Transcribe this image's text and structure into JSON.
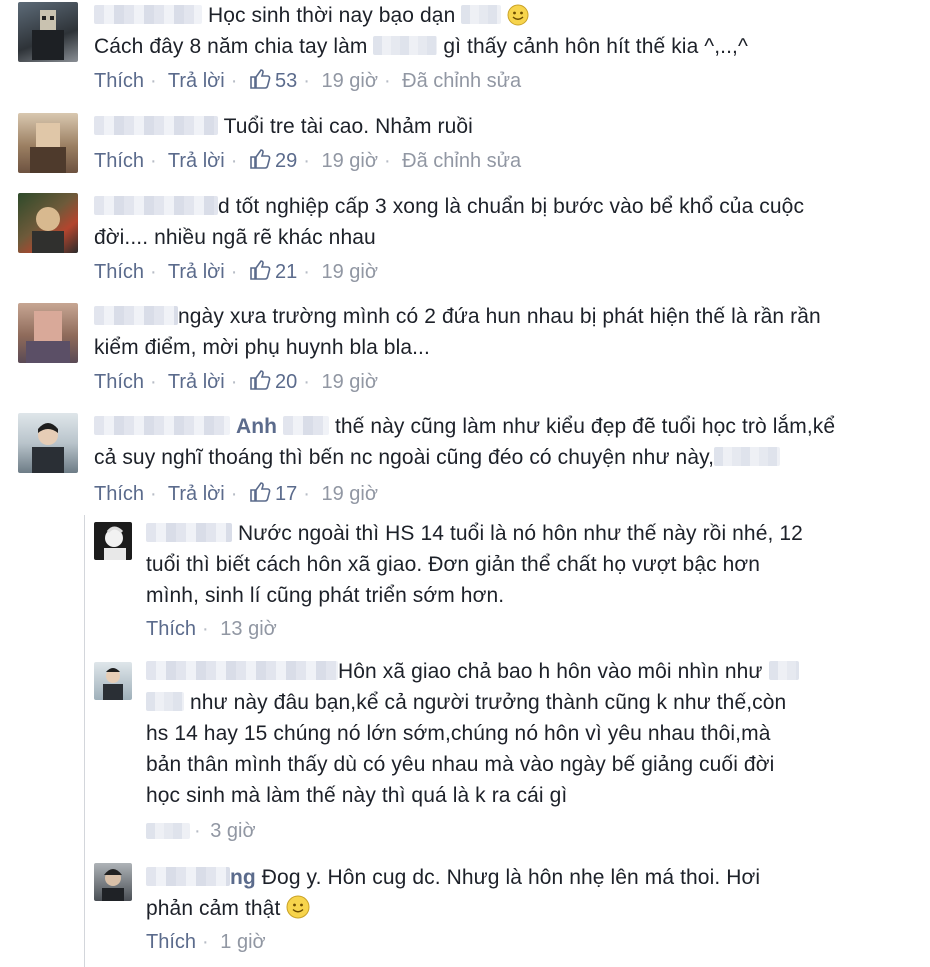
{
  "comments": [
    {
      "text_parts": [
        "Học sinh thời nay bạo dạn",
        "Cách đây 8 năm chia tay làm",
        "gì thấy cảnh hôn hít thế kia ^,..,^"
      ],
      "actions": {
        "like": "Thích",
        "reply": "Trả lời",
        "likes": "53",
        "time": "19 giờ",
        "edited": "Đã chỉnh sửa"
      }
    },
    {
      "text_parts": [
        "Tuổi tre tài cao. Nhảm ruồi"
      ],
      "actions": {
        "like": "Thích",
        "reply": "Trả lời",
        "likes": "29",
        "time": "19 giờ",
        "edited": "Đã chỉnh sửa"
      }
    },
    {
      "text_parts": [
        "d tốt nghiệp cấp 3 xong là chuẩn bị bước vào bể khổ của cuộc",
        "đời.... nhiều ngã rẽ khác nhau"
      ],
      "actions": {
        "like": "Thích",
        "reply": "Trả lời",
        "likes": "21",
        "time": "19 giờ"
      }
    },
    {
      "text_parts": [
        "ngày xưa trường mình có 2 đứa hun nhau bị phát hiện thế là rần rần",
        "kiểm điểm, mời phụ huynh bla bla..."
      ],
      "actions": {
        "like": "Thích",
        "reply": "Trả lời",
        "likes": "20",
        "time": "19 giờ"
      }
    },
    {
      "name_fragment": "Anh",
      "text_parts": [
        "thế này cũng làm như kiểu đẹp đẽ tuổi học trò lắm,kể",
        "cả suy nghĩ thoáng thì bến nc ngoài cũng đéo có chuyện như này,"
      ],
      "actions": {
        "like": "Thích",
        "reply": "Trả lời",
        "likes": "17",
        "time": "19 giờ"
      }
    }
  ],
  "replies": [
    {
      "text_parts": [
        "Nước ngoài thì HS 14 tuổi là nó hôn như thế này rồi nhé, 12",
        "tuổi thì biết cách hôn xã giao. Đơn giản thể chất họ vượt bậc hơn",
        "mình, sinh lí cũng phát triển sớm hơn."
      ],
      "actions": {
        "like": "Thích",
        "time": "13 giờ"
      }
    },
    {
      "text_parts": [
        "Hôn xã giao chả bao h hôn vào môi nhìn như",
        "như này đâu bạn,kể cả người trưởng thành cũng k như thế,còn",
        "hs 14 hay 15 chúng nó lớn sớm,chúng nó hôn vì yêu nhau thôi,mà",
        "bản thân mình thấy dù có yêu nhau mà vào ngày bế giảng cuối đời",
        "học sinh mà làm thế này thì quá là k ra cái gì"
      ],
      "actions": {
        "time": "3 giờ"
      }
    },
    {
      "name_fragment": "ng",
      "text_parts": [
        "Đog y. Hôn cug dc. Nhưg là hôn nhẹ lên má thoi. Hơi",
        "phản cảm thật"
      ],
      "actions": {
        "like": "Thích",
        "time": "1 giờ"
      }
    }
  ],
  "colors": {
    "link": "#5b6b8c",
    "meta": "#9197a3",
    "text": "#1d2129",
    "like_icon": "#5b6b8c"
  }
}
